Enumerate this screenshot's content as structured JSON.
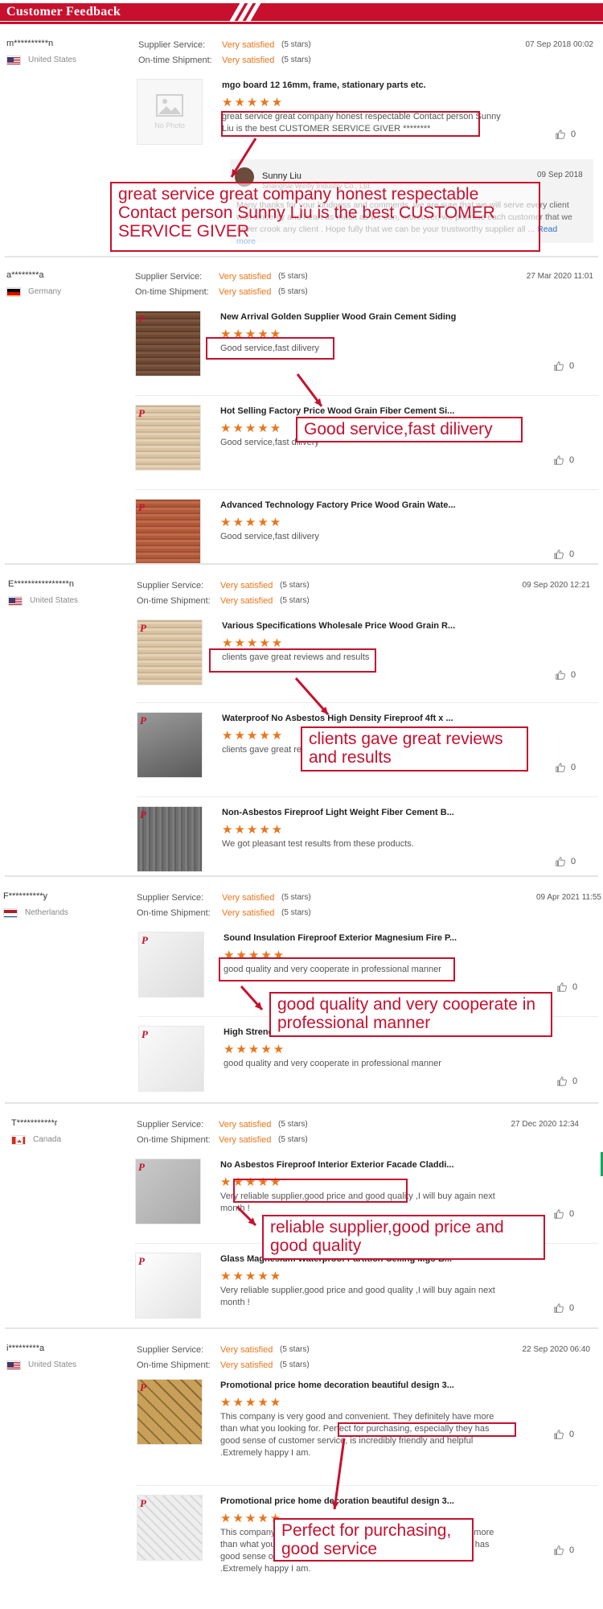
{
  "header": {
    "title": "Customer Feedback"
  },
  "labels": {
    "supplier_service": "Supplier Service:",
    "ontime_shipment": "On-time Shipment:",
    "no_photo": "No Photo",
    "read_more": "Read more"
  },
  "colors": {
    "accent": "#c8102e",
    "rating": "#e8761c",
    "link": "#2a6fc9"
  },
  "reviews": [
    {
      "buyer": "m**********n",
      "country": "United States",
      "flag": "us",
      "date": "07 Sep 2018 00:02",
      "supplier_service": "Very satisfied",
      "supplier_stars": "(5 stars)",
      "shipment": "Very satisfied",
      "shipment_stars": "(5 stars)",
      "products": [
        {
          "title": "mgo board 12 16mm, frame, stationary parts etc.",
          "stars": "★★★★★",
          "comment": "great service great company honest respectable Contact person Sunny Liu is the best CUSTOMER SERVICE GIVER ********",
          "likes": "0",
          "thumb": "none"
        }
      ],
      "reply": {
        "name": "Sunny Liu",
        "company": "Shanghai Winfly Industry Co., Ltd.",
        "date": "09 Sep 2018",
        "text": "Many thanks for your kindness and comments, we are sure that we will serve every client with sincerity and heart as much as we can, moreover, we promise each customer that we never crook any client .                    Hope fully that we can be your trustworthy supplier all ...",
        "read_more": "Read more"
      },
      "annotation": "great service great company honest respectable Contact person Sunny Liu is the best CUSTOMER SERVICE GIVER"
    },
    {
      "buyer": "a********a",
      "country": "Germany",
      "flag": "de",
      "date": "27 Mar 2020 11:01",
      "supplier_service": "Very satisfied",
      "supplier_stars": "(5 stars)",
      "shipment": "Very satisfied",
      "shipment_stars": "(5 stars)",
      "products": [
        {
          "title": "New Arrival Golden Supplier Wood Grain Cement Siding",
          "stars": "★★★★★",
          "comment": "Good service,fast dilivery",
          "likes": "0",
          "thumb": "wood-brown"
        },
        {
          "title": "Hot Selling Factory Price Wood Grain Fiber Cement Si...",
          "stars": "★★★★★",
          "comment": "Good service,fast dilivery",
          "likes": "0",
          "thumb": "wood-beige"
        },
        {
          "title": "Advanced Technology Factory Price Wood Grain Wate...",
          "stars": "★★★★★",
          "comment": "Good service,fast dilivery",
          "likes": "0",
          "thumb": "wood-red"
        }
      ],
      "annotation": "Good service,fast dilivery"
    },
    {
      "buyer": "E****************n",
      "country": "United States",
      "flag": "us",
      "date": "09 Sep 2020 12:21",
      "supplier_service": "Very satisfied",
      "supplier_stars": "(5 stars)",
      "shipment": "Very satisfied",
      "shipment_stars": "(5 stars)",
      "products": [
        {
          "title": "Various Specifications Wholesale Price Wood Grain R...",
          "stars": "★★★★★",
          "comment": "clients gave great reviews and results",
          "likes": "0",
          "thumb": "wood-beige"
        },
        {
          "title": "Waterproof No Asbestos High Density Fireproof 4ft x ...",
          "stars": "★★★★★",
          "comment": "clients gave great reviews and results",
          "likes": "0",
          "thumb": "grey-boards"
        },
        {
          "title": "Non-Asbestos Fireproof Light Weight Fiber Cement B...",
          "stars": "★★★★★",
          "comment": "We got pleasant test results from these products.",
          "likes": "0",
          "thumb": "grey-wood"
        }
      ],
      "annotation": "clients gave great reviews and results"
    },
    {
      "buyer": "F**********y",
      "country": "Netherlands",
      "flag": "nl",
      "date": "09 Apr 2021 11:55",
      "supplier_service": "Very satisfied",
      "supplier_stars": "(5 stars)",
      "shipment": "Very satisfied",
      "shipment_stars": "(5 stars)",
      "products": [
        {
          "title": "Sound Insulation Fireproof Exterior Magnesium Fire P...",
          "stars": "★★★★★",
          "comment": "good quality and very cooperate in professional manner",
          "likes": "0",
          "thumb": "white-sheets"
        },
        {
          "title": "High Strength Waterproof No Sweating No Chloride M...",
          "stars": "★★★★★",
          "comment": "good quality and very cooperate in professional manner",
          "likes": "0",
          "thumb": "white-board"
        }
      ],
      "annotation": "good quality and very cooperate in professional manner"
    },
    {
      "buyer": "T***********r",
      "country": "Canada",
      "flag": "ca",
      "date": "27 Dec 2020 12:34",
      "supplier_service": "Very satisfied",
      "supplier_stars": "(5 stars)",
      "shipment": "Very satisfied",
      "shipment_stars": "(5 stars)",
      "products": [
        {
          "title": "No Asbestos Fireproof Interior Exterior Facade Claddi...",
          "stars": "★★★★★",
          "comment": "Very reliable supplier,good price and good quality ,I will buy again next month !",
          "likes": "0",
          "thumb": "grey-panel"
        },
        {
          "title": "Glass Magnesium Waterproof Partition Ceiling Mgo B...",
          "stars": "★★★★★",
          "comment": "Very reliable supplier,good price and good quality ,I will buy again next month !",
          "likes": "0",
          "thumb": "white-stack"
        }
      ],
      "annotation": "reliable supplier,good price and good quality"
    },
    {
      "buyer": "i*********a",
      "country": "United States",
      "flag": "us",
      "date": "22 Sep 2020 06:40",
      "supplier_service": "Very satisfied",
      "supplier_stars": "(5 stars)",
      "shipment": "Very satisfied",
      "shipment_stars": "(5 stars)",
      "products": [
        {
          "title": "Promotional price home decoration beautiful design 3...",
          "stars": "★★★★★",
          "comment": "This company is very good and convenient. They definitely have more than what you looking for. Perfect for purchasing, especially they has good sense of customer service, is incredibly friendly and helpful .Extremely happy I am.",
          "likes": "0",
          "thumb": "gold-quilt"
        },
        {
          "title": "Promotional price home decoration beautiful design 3...",
          "stars": "★★★★★",
          "comment": "This company is very good and convenient. They definitely have more than what you looking for. Perfect for purchasing, especially they has good sense of customer service, is incredibly friendly and helpful .Extremely happy I am.",
          "likes": "0",
          "thumb": "white-pattern"
        }
      ],
      "annotation": "Perfect for purchasing, good service"
    }
  ]
}
